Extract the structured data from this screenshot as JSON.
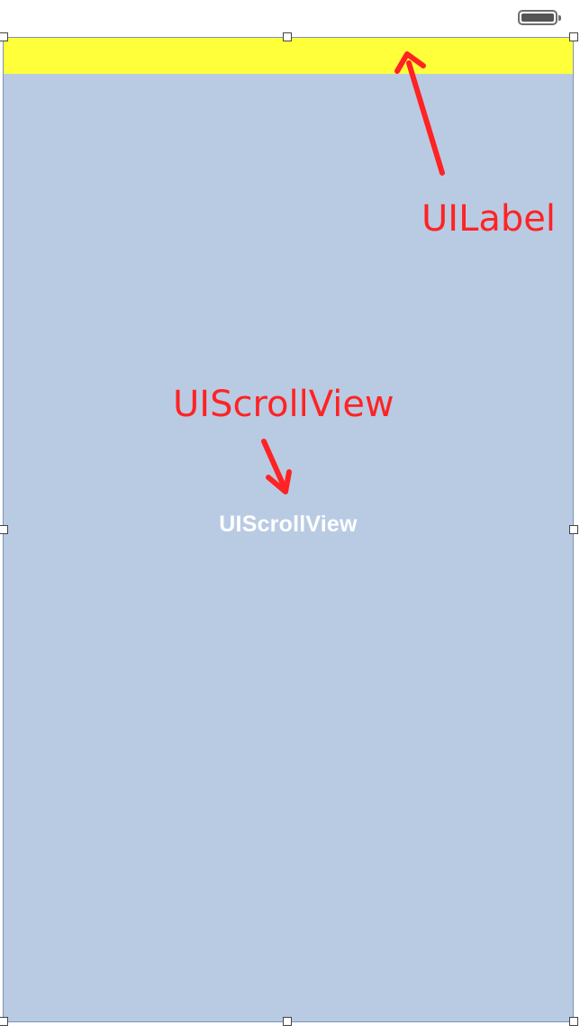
{
  "annotations": {
    "label_callout": "UILabel",
    "scroll_callout": "UIScrollView"
  },
  "scroll_view": {
    "caption": "UIScrollView",
    "background_color": "#b9cbe3"
  },
  "label_bar": {
    "background_color": "#ffff3a"
  },
  "status_bar": {
    "battery_level": 1.0
  },
  "colors": {
    "annotation": "#ff2323",
    "selection_border": "#7d93b8"
  }
}
